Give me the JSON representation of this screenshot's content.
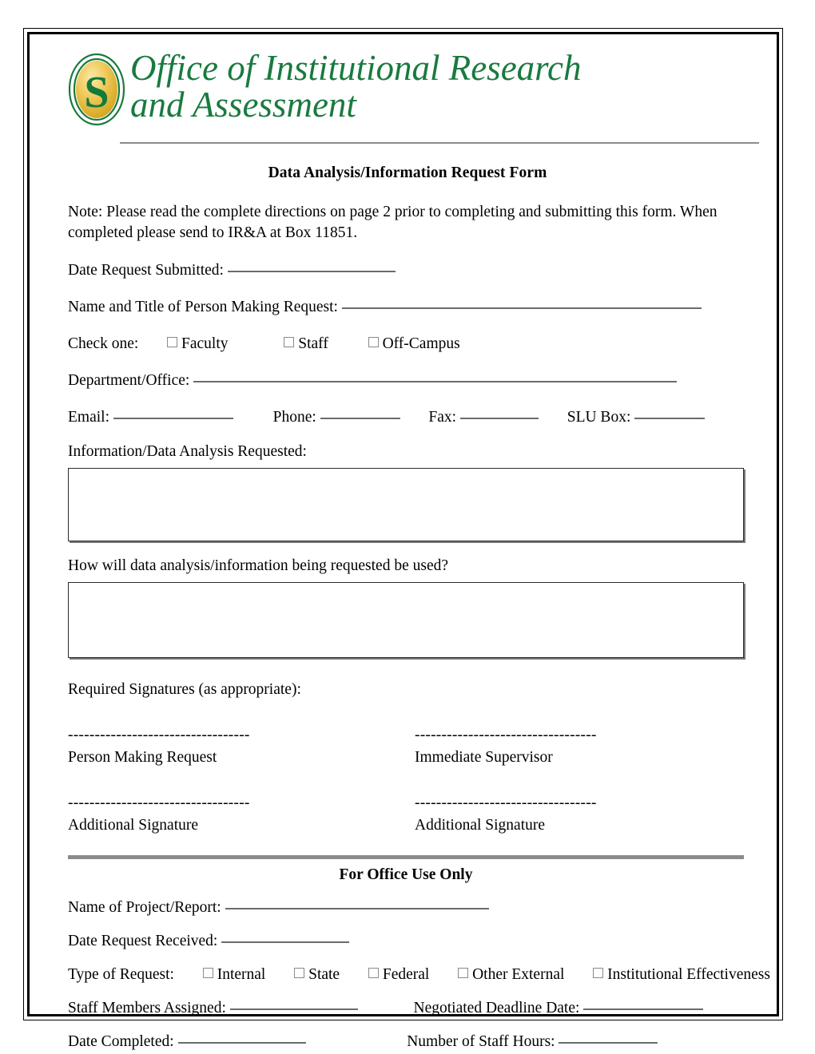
{
  "page": {
    "border_color": "#000000",
    "background": "#ffffff"
  },
  "header": {
    "logo_icon": "oval-s-seal-icon",
    "logo_colors": {
      "green": "#1a7a3f",
      "gold_light": "#f7dc82",
      "gold_dark": "#d5a118"
    },
    "logo_letter": "S",
    "wordmark_line1": "Office of  Institutional Research",
    "wordmark_line2": "and Assessment",
    "rule_color": "#8b8b8b"
  },
  "title": "Data Analysis/Information Request Form",
  "note": "Note: Please read the complete directions on page 2 prior to completing and submitting this form. When completed please send to IR&A at Box 11851.",
  "fields": {
    "date_request_submitted_label": "Date Request Submitted:",
    "name_and_title_label": "Name and Title of Person Making Request:",
    "check_one_label": "Check one:",
    "check_one_options": [
      "Faculty",
      "Staff",
      "Off-Campus"
    ],
    "department_office_label": "Department/Office:",
    "email_label": "Email:",
    "phone_label": "Phone:",
    "fax_label": "Fax:",
    "slu_box_label": "SLU Box:",
    "information_requested_label": "Information/Data Analysis Requested:",
    "information_requested_value": "",
    "how_used_label": "How will data analysis/information being requested be used?",
    "how_used_value": ""
  },
  "signatures": {
    "section_label": "Required Signatures (as appropriate):",
    "rule": "----------------------------------",
    "rows": [
      {
        "left": "Person Making Request",
        "right": "Immediate Supervisor"
      },
      {
        "left": "Additional Signature",
        "right": "Additional Signature"
      }
    ]
  },
  "office_use": {
    "heading": "For Office Use Only",
    "rule_color": "#8b8b8b",
    "name_of_project_label": "Name of Project/Report:",
    "date_request_received_label": "Date Request Received:",
    "type_of_request_label": "Type of Request:",
    "type_of_request_options": [
      "Internal",
      "State",
      "Federal",
      "Other External",
      "Institutional Effectiveness"
    ],
    "staff_members_assigned_label": "Staff Members Assigned:",
    "negotiated_deadline_label": "Negotiated Deadline Date:",
    "date_completed_label": "Date Completed:",
    "number_of_staff_hours_label": "Number of Staff Hours:"
  }
}
